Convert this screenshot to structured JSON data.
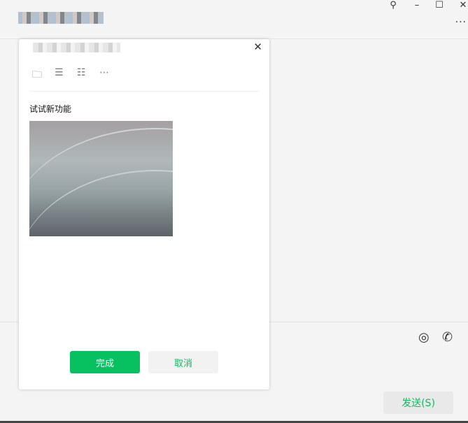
{
  "window": {
    "pin": "⚲",
    "minimize": "–",
    "maximize": "☐",
    "close": "✕",
    "more": "···"
  },
  "chat": {
    "send_label": "发送(S)",
    "icons": {
      "screenshot": "◎",
      "call": "✆"
    }
  },
  "dialog": {
    "close": "✕",
    "toolbar": [
      "🗀",
      "☰",
      "☷",
      "⋯"
    ],
    "text": "试试新功能",
    "ok_label": "完成",
    "cancel_label": "取消"
  }
}
